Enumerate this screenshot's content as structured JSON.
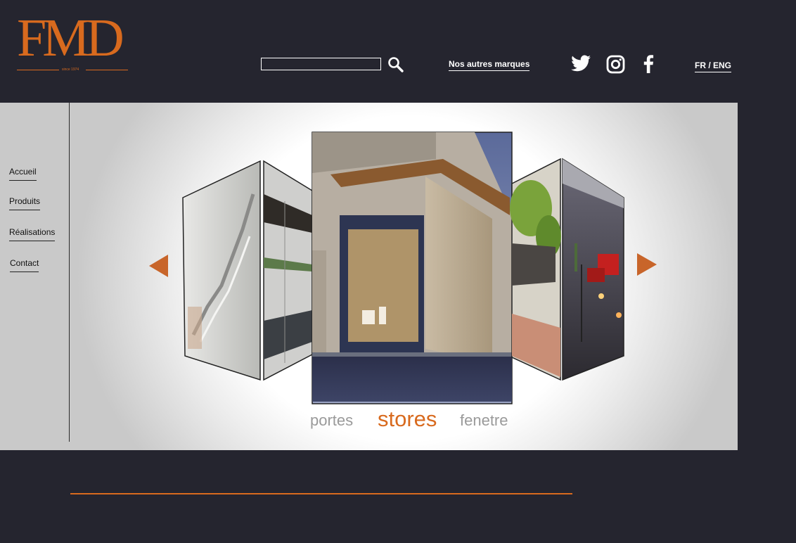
{
  "brand": {
    "logo_text": "FMD",
    "since": "since 1974",
    "accent_color": "#d86a1e",
    "background_color": "#25252f"
  },
  "header": {
    "search": {
      "value": "",
      "placeholder": "",
      "icon": "search-icon"
    },
    "other_brands": "Nos autres marques",
    "social": [
      {
        "icon": "twitter-icon"
      },
      {
        "icon": "instagram-icon"
      },
      {
        "icon": "facebook-icon"
      }
    ],
    "lang": {
      "fr": "FR",
      "separator": " / ",
      "eng": "ENG"
    }
  },
  "sidebar": {
    "items": [
      {
        "label": "Accueil"
      },
      {
        "label": "Produits"
      },
      {
        "label": "Réalisations"
      },
      {
        "label": "Contact"
      }
    ]
  },
  "carousel": {
    "prev_icon": "chevron-left-icon",
    "next_icon": "chevron-right-icon",
    "categories": [
      {
        "label": "portes",
        "active": false
      },
      {
        "label": "stores",
        "active": true
      },
      {
        "label": "fenetre",
        "active": false
      }
    ]
  }
}
